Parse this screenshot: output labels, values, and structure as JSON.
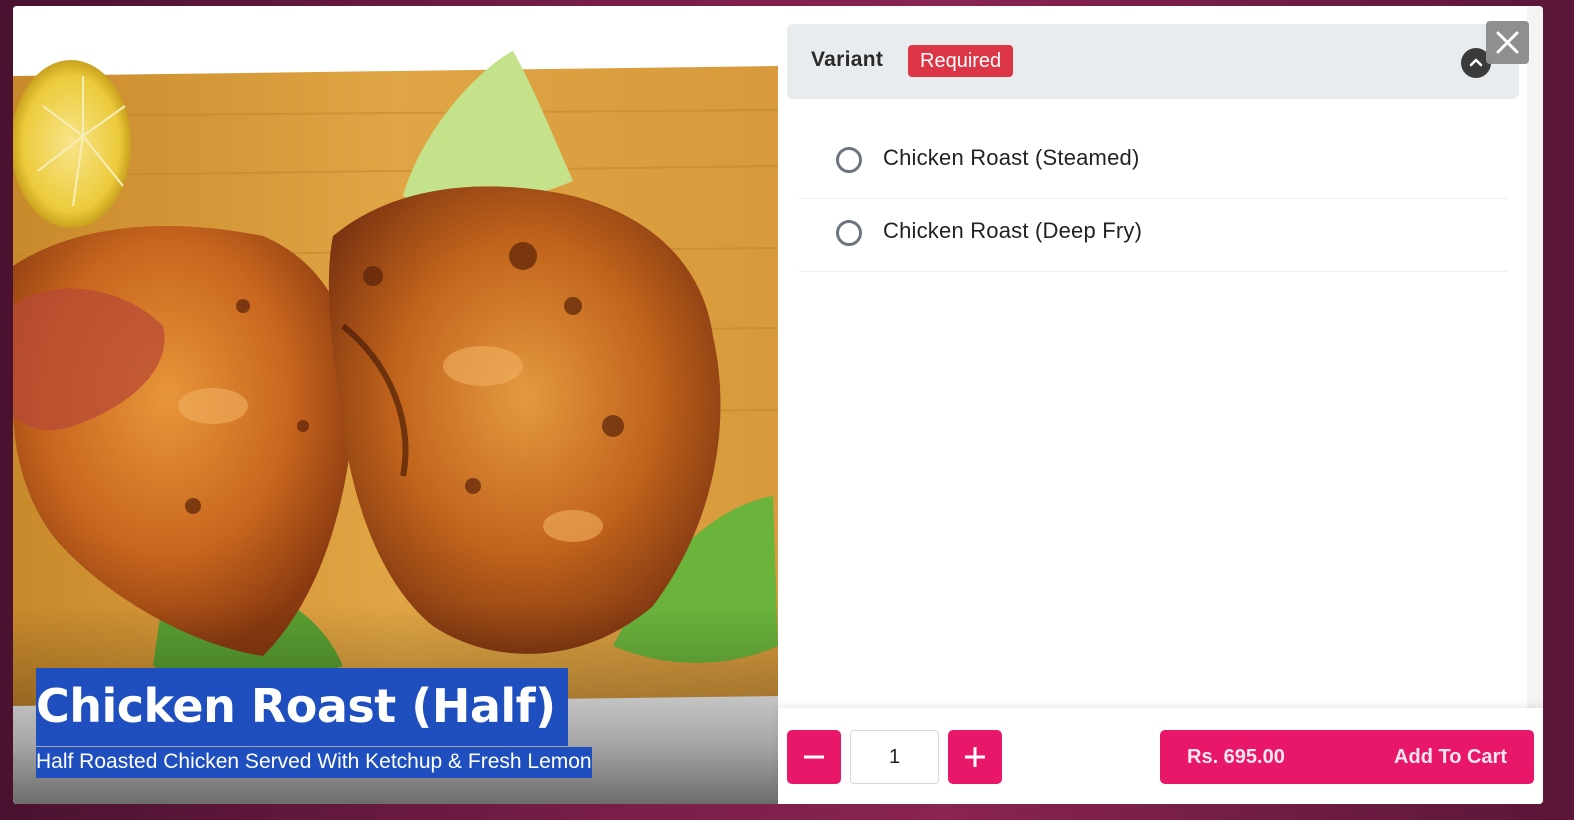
{
  "product": {
    "title": "Chicken Roast (Half)",
    "description": "Half Roasted Chicken Served With Ketchup & Fresh Lemon"
  },
  "variant": {
    "title": "Variant",
    "badge": "Required",
    "options": [
      {
        "label": "Chicken Roast (Steamed)",
        "selected": false
      },
      {
        "label": "Chicken Roast (Deep Fry)",
        "selected": false
      }
    ]
  },
  "footer": {
    "quantity": "1",
    "price": "Rs. 695.00",
    "add_to_cart": "Add To Cart"
  },
  "icons": {
    "close": "close-icon",
    "collapse": "chevron-up-icon",
    "minus": "minus-icon",
    "plus": "plus-icon"
  },
  "colors": {
    "accent": "#e8176a",
    "badge": "#dc3545",
    "title_highlight": "#1f4fbf"
  }
}
